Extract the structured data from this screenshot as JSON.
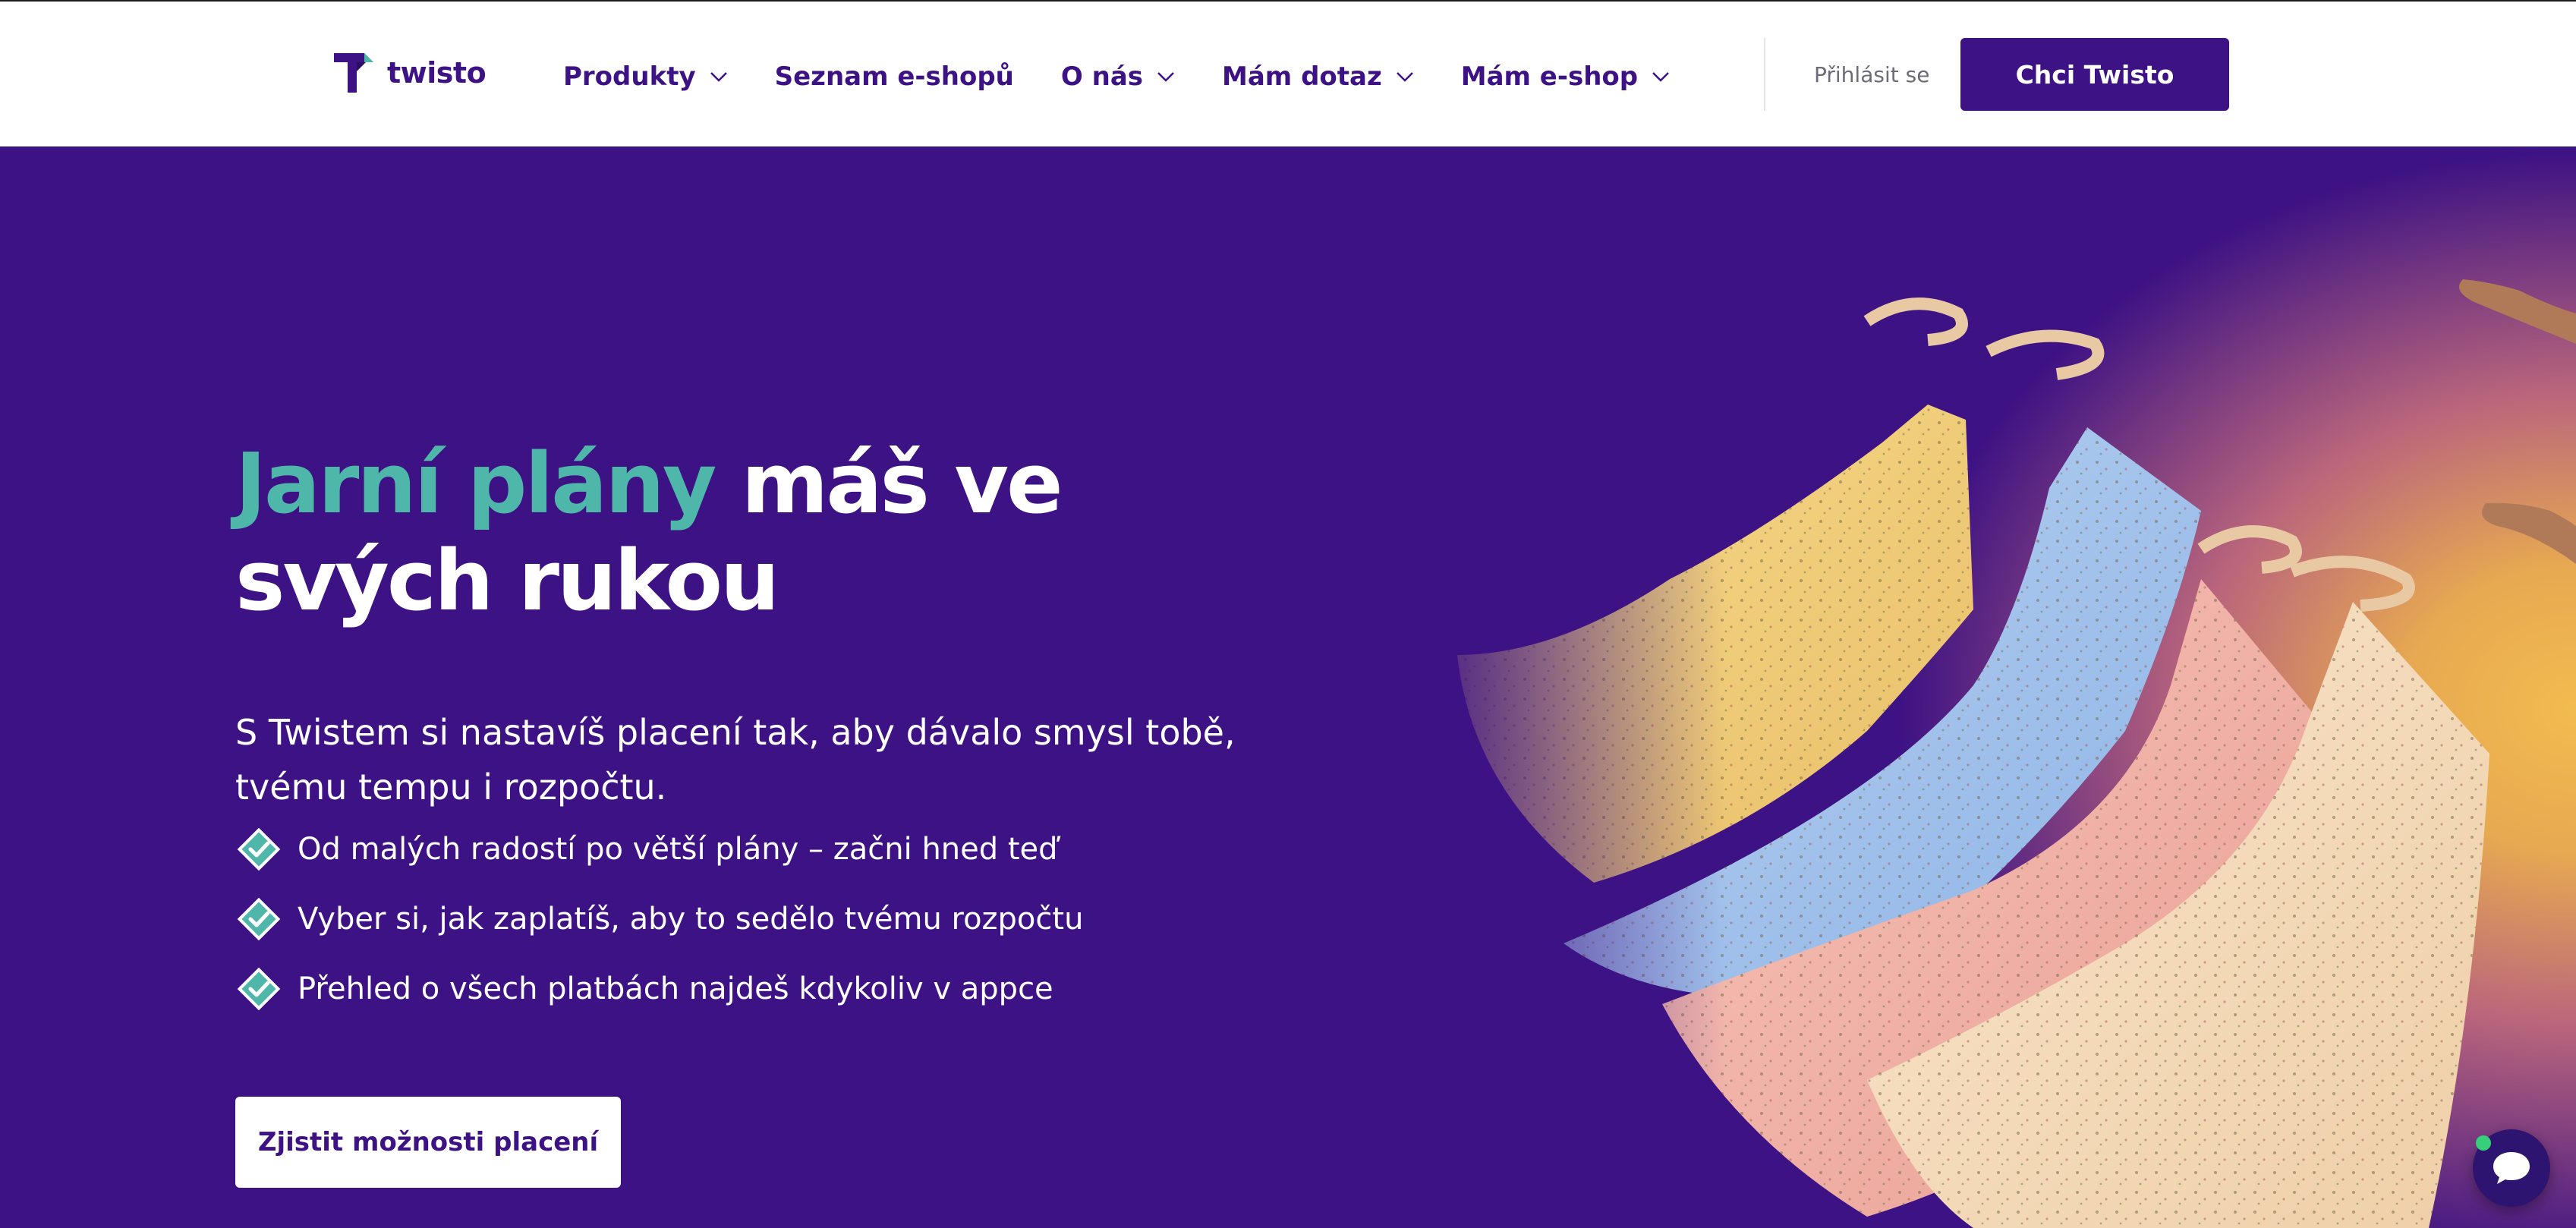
{
  "brand": {
    "name": "twisto",
    "color": "#3d1284",
    "accent": "#4fb7a9"
  },
  "nav": {
    "items": [
      {
        "label": "Produkty",
        "has_dropdown": true
      },
      {
        "label": "Seznam e-shopů",
        "has_dropdown": false
      },
      {
        "label": "O nás",
        "has_dropdown": true
      },
      {
        "label": "Mám dotaz",
        "has_dropdown": true
      },
      {
        "label": "Mám e-shop",
        "has_dropdown": true
      }
    ],
    "login_label": "Přihlásit se",
    "cta_label": "Chci Twisto"
  },
  "hero": {
    "headline_accent": "Jarní plány",
    "headline_rest": " máš ve svých rukou",
    "lead": "S Twistem si nastavíš placení tak, aby dávalo smysl tobě, tvému tempu i rozpočtu.",
    "benefits": [
      "Od malých radostí po větší plány – začni hned teď",
      "Vyber si, jak zaplatíš, aby to sedělo tvému rozpočtu",
      "Přehled o všech platbách najdeš kdykoliv v appce"
    ],
    "cta_label": "Zjistit možnosti placení"
  },
  "icons": {
    "logo": "twisto-logo-icon",
    "chevron": "chevron-down-icon",
    "check": "check-diamond-icon",
    "chat": "chat-bubble-icon"
  }
}
